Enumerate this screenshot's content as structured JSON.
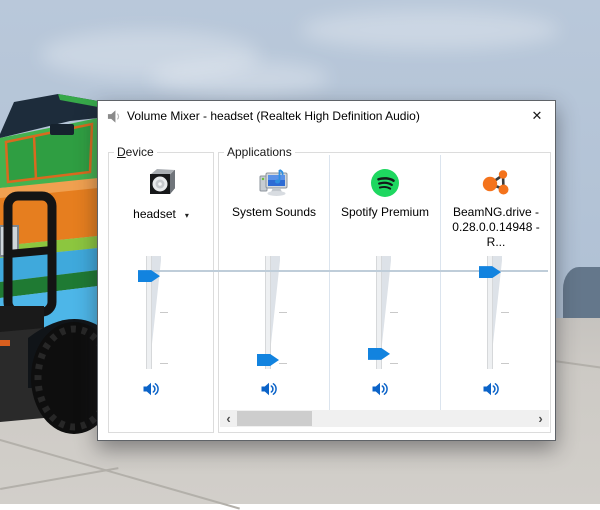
{
  "window": {
    "title": "Volume Mixer - headset (Realtek High Definition Audio)",
    "close_glyph": "✕"
  },
  "device": {
    "group_label": "Device",
    "selected_device": "headset",
    "dropdown_glyph": "▾",
    "level_percent": 86
  },
  "applications": {
    "group_label": "Applications",
    "items": [
      {
        "label": "System Sounds",
        "icon": "system-sounds-icon",
        "level_percent": 3
      },
      {
        "label": "Spotify Premium",
        "icon": "spotify-icon",
        "level_percent": 9
      },
      {
        "label": "BeamNG.drive - 0.28.0.0.14948 - R...",
        "icon": "beamng-icon",
        "level_percent": 90
      }
    ],
    "scrollbar": {
      "left_arrow": "‹",
      "right_arrow": "›"
    }
  },
  "colors": {
    "thumb": "#1283df",
    "line": "#bfcdd9",
    "mute_speaker": "#0b63c8",
    "spotify_green": "#1ed760",
    "beamng_orange": "#f4731c",
    "sky": "#b3c3d6",
    "ground": "#cdcac5",
    "rock": "#64778b"
  }
}
